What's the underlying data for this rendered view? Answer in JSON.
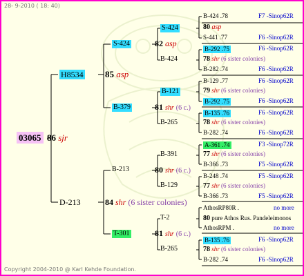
{
  "header": {
    "date": "28-  9-2010 ( 18: 40)"
  },
  "footer": {
    "copyright": "Copyright 2004-2010 @ Karl Kehde Foundation."
  },
  "root": {
    "id": "03065",
    "year": "86",
    "race": "sjr"
  },
  "sire": {
    "id": "H8534",
    "year": "85",
    "race": "asp"
  },
  "dam": {
    "id": "D-213",
    "year": "84",
    "race": "shr",
    "note": "(6 sister colonies)"
  },
  "s_s": {
    "id": "S-424",
    "year": "82",
    "race": "asp"
  },
  "s_d": {
    "id": "B-379",
    "year": "81",
    "race": "shr",
    "note": "(6 c.)"
  },
  "d_s": {
    "id": "B-213",
    "year": "80",
    "race": "shr",
    "note": "(6 c.)"
  },
  "d_d": {
    "id": "T-301",
    "year": "81",
    "race": "shr",
    "note": "(6 c.)"
  },
  "g1": {
    "a": "S-424",
    "b": "B-424"
  },
  "g2": {
    "a": "B-121",
    "b": "B-265",
    "year": "79",
    "race": "shr"
  },
  "g3": {
    "a": "B-391",
    "b": "B-129"
  },
  "g4": {
    "a": "T-2",
    "b": "B-265"
  },
  "gen4": [
    {
      "id": "B-424 .78",
      "right": "F7 -Sinop62R"
    },
    {
      "year": "80",
      "race": "asp"
    },
    {
      "id": "S-441 .77",
      "right": "F6 -Sinop62R"
    },
    {
      "id": "B-292 .75",
      "right": "F6 -Sinop62R"
    },
    {
      "year": "78",
      "race": "shr",
      "note": "(6 sister colonies)"
    },
    {
      "id": "B-282 .74",
      "right": "F6 -Sinop62R"
    },
    {
      "id": "B-129 .77",
      "right": "F6 -Sinop62R"
    },
    {
      "year": "79",
      "race": "shr",
      "note": "(6 sister colonies)"
    },
    {
      "id": "B-292 .75",
      "right": "F6 -Sinop62R"
    },
    {
      "id": "B-135 .76",
      "right": "F6 -Sinop62R"
    },
    {
      "year": "78",
      "race": "shr",
      "note": "(6 sister colonies)"
    },
    {
      "id": "B-282 .74",
      "right": "F6 -Sinop62R"
    },
    {
      "id": "A-361 .74",
      "right": "F3 -Sinop72R"
    },
    {
      "year": "77",
      "race": "shr",
      "note": "(6 sister colonies)"
    },
    {
      "id": "B-366 .73",
      "right": "F5 -Sinop62R"
    },
    {
      "id": "B-248 .74",
      "right": "F5 -Sinop62R"
    },
    {
      "year": "77",
      "race": "shr",
      "note": "(6 sister colonies)"
    },
    {
      "id": "B-366 .73",
      "right": "F5 -Sinop62R"
    },
    {
      "id": "AthosRP80R .",
      "right": "no more"
    },
    {
      "year": "80",
      "text": "pure Athos Rus. Pandeleimonos"
    },
    {
      "id": "AthosRPM .",
      "right": "no more"
    },
    {
      "id": "B-135 .76",
      "right": "F6 -Sinop62R"
    },
    {
      "year": "78",
      "race": "shr",
      "note": "(6 sister colonies)"
    },
    {
      "id": "B-282 .74",
      "right": "F6 -Sinop62R"
    }
  ]
}
